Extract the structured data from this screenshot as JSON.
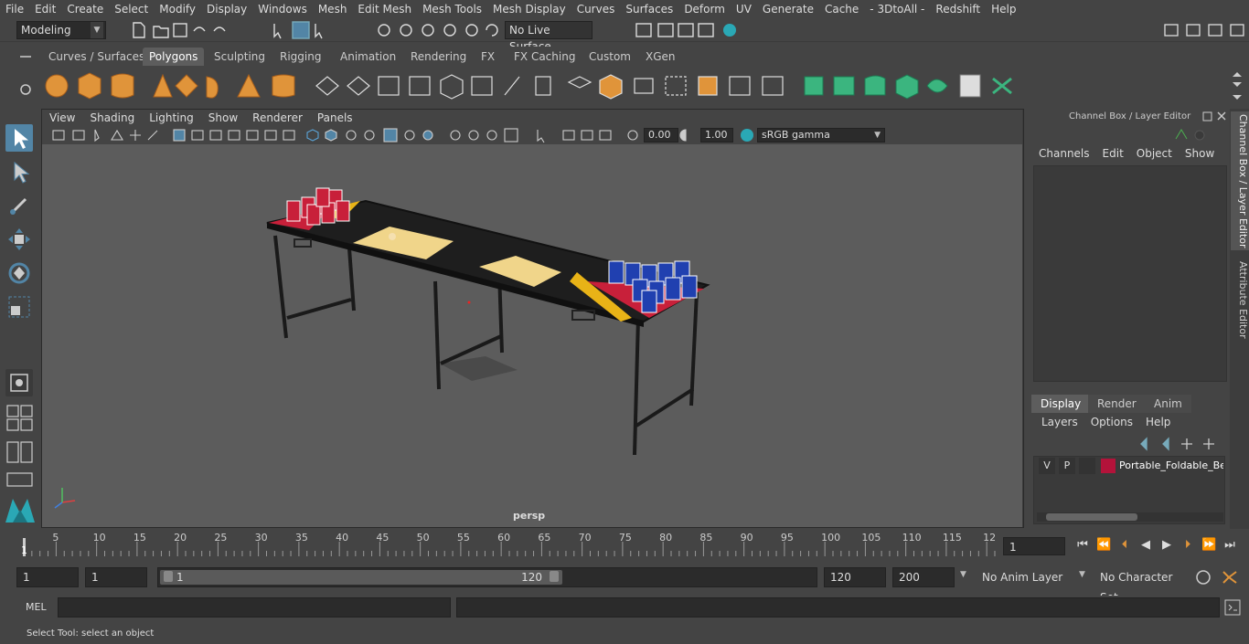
{
  "menubar": {
    "items": [
      "File",
      "Edit",
      "Create",
      "Select",
      "Modify",
      "Display",
      "Windows",
      "Mesh",
      "Edit Mesh",
      "Mesh Tools",
      "Mesh Display",
      "Curves",
      "Surfaces",
      "Deform",
      "UV",
      "Generate",
      "Cache",
      "- 3DtoAll -",
      "Redshift",
      "Help"
    ]
  },
  "statusline": {
    "mode": "Modeling",
    "live_surface": "No Live Surface"
  },
  "shelf": {
    "tabs": [
      "Curves / Surfaces",
      "Polygons",
      "Sculpting",
      "Rigging",
      "Animation",
      "Rendering",
      "FX",
      "FX Caching",
      "Custom",
      "XGen"
    ],
    "active_tab": "Polygons"
  },
  "viewport": {
    "menu": [
      "View",
      "Shading",
      "Lighting",
      "Show",
      "Renderer",
      "Panels"
    ],
    "exposure": "0.00",
    "gamma": "1.00",
    "color_space": "sRGB gamma",
    "camera_label": "persp"
  },
  "channel_box": {
    "title": "Channel Box / Layer Editor",
    "menu": [
      "Channels",
      "Edit",
      "Object",
      "Show"
    ]
  },
  "layer_editor": {
    "tabs": [
      "Display",
      "Render",
      "Anim"
    ],
    "active_tab": "Display",
    "menu": [
      "Layers",
      "Options",
      "Help"
    ],
    "layers": [
      {
        "v": "V",
        "p": "P",
        "name": "Portable_Foldable_Bee",
        "color": "#b3133a"
      }
    ]
  },
  "side_tabs": [
    "Channel Box / Layer Editor",
    "Attribute Editor"
  ],
  "timeline": {
    "ticks": [
      "5",
      "10",
      "15",
      "20",
      "25",
      "30",
      "35",
      "40",
      "45",
      "50",
      "55",
      "60",
      "65",
      "70",
      "75",
      "80",
      "85",
      "90",
      "95",
      "100",
      "105",
      "110",
      "115",
      "12"
    ],
    "current_frame_marker": "1",
    "current_frame_field": "1"
  },
  "range": {
    "start": "1",
    "playback_start": "1",
    "slider_start": "1",
    "slider_end": "120",
    "playback_end": "120",
    "end": "200",
    "anim_layer": "No Anim Layer",
    "character_set": "No Character Set"
  },
  "cmdline": {
    "lang": "MEL"
  },
  "helpline": {
    "text": "Select Tool: select an object"
  },
  "colors": {
    "accent": "#5285a6",
    "maya_teal": "#2aa8b5",
    "shelf_orange": "#e0943a",
    "shelf_green": "#3bb57f",
    "cup_red": "#c8203a",
    "cup_blue": "#2040b0"
  }
}
